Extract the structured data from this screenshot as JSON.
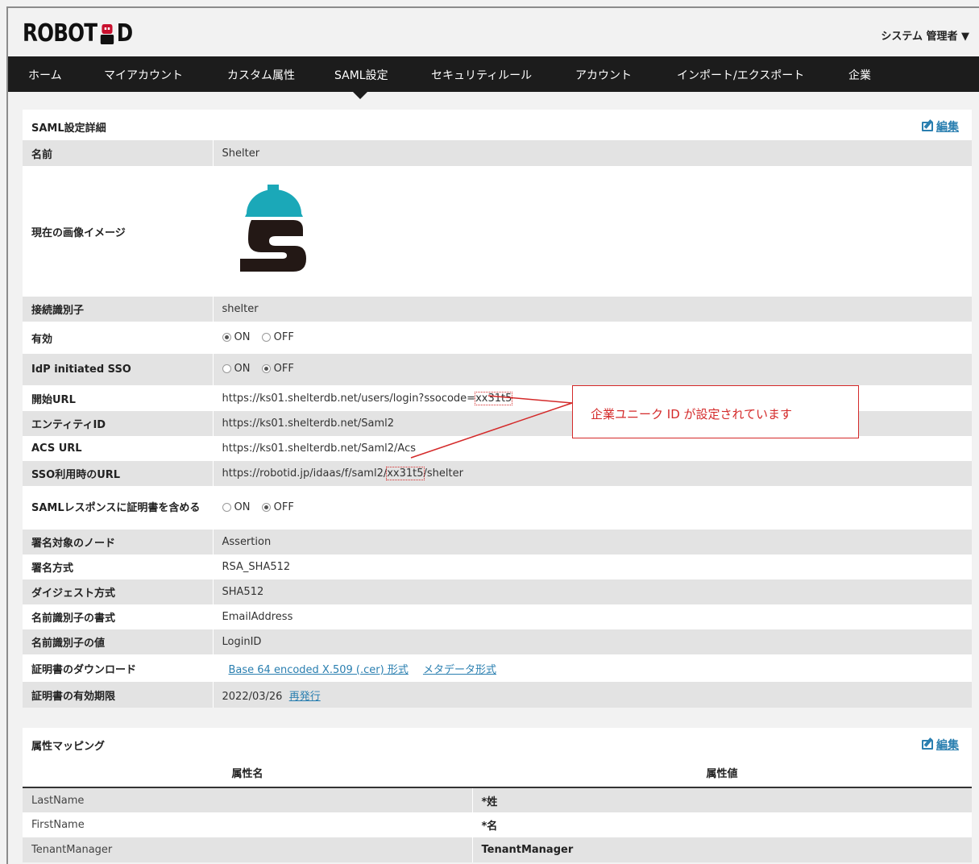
{
  "header": {
    "logo_text_left": "ROBOT",
    "logo_text_right": "D",
    "user_menu": "システム 管理者 ▼"
  },
  "nav": {
    "items": [
      "ホーム",
      "マイアカウント",
      "カスタム属性",
      "SAML設定",
      "セキュリティルール",
      "アカウント",
      "インポート/エクスポート",
      "企業"
    ],
    "active": "SAML設定"
  },
  "saml_panel": {
    "title": "SAML設定詳細",
    "edit_label": "編集",
    "rows": {
      "name_label": "名前",
      "name_value": "Shelter",
      "image_label": "現在の画像イメージ",
      "conn_id_label": "接続識別子",
      "conn_id_value": "shelter",
      "enabled_label": "有効",
      "idp_label": "IdP initiated SSO",
      "start_url_label": "開始URL",
      "start_url_prefix": "https://ks01.shelterdb.net/users/login?ssocode=",
      "start_url_code": "xx31t5",
      "entity_id_label": "エンティティID",
      "entity_id_value": "https://ks01.shelterdb.net/Saml2",
      "acs_label": "ACS URL",
      "acs_value": "https://ks01.shelterdb.net/Saml2/Acs",
      "sso_url_label": "SSO利用時のURL",
      "sso_url_prefix": "https://robotid.jp/idaas/f/saml2/",
      "sso_url_code": "xx31t5",
      "sso_url_suffix": "/shelter",
      "include_cert_label": "SAMLレスポンスに証明書を含める",
      "sign_node_label": "署名対象のノード",
      "sign_node_value": "Assertion",
      "sign_method_label": "署名方式",
      "sign_method_value": "RSA_SHA512",
      "digest_label": "ダイジェスト方式",
      "digest_value": "SHA512",
      "nameid_format_label": "名前識別子の書式",
      "nameid_format_value": "EmailAddress",
      "nameid_value_label": "名前識別子の値",
      "nameid_value_value": "LoginID",
      "cert_download_label": "証明書のダウンロード",
      "cert_download_link1": "Base 64 encoded X.509 (.cer) 形式",
      "cert_download_link2": "メタデータ形式",
      "cert_expiry_label": "証明書の有効期限",
      "cert_expiry_value": "2022/03/26",
      "cert_reissue_link": "再発行"
    },
    "radio_on": "ON",
    "radio_off": "OFF",
    "enabled_state": "ON",
    "idp_state": "OFF",
    "include_cert_state": "OFF"
  },
  "callout": {
    "text": "企業ユニーク ID が設定されています",
    "color": "#d42a2a"
  },
  "attr_panel": {
    "title": "属性マッピング",
    "edit_label": "編集",
    "col_name": "属性名",
    "col_value": "属性値",
    "rows": [
      {
        "name": "LastName",
        "value": "*姓"
      },
      {
        "name": "FirstName",
        "value": "*名"
      },
      {
        "name": "TenantManager",
        "value": "TenantManager"
      }
    ]
  }
}
